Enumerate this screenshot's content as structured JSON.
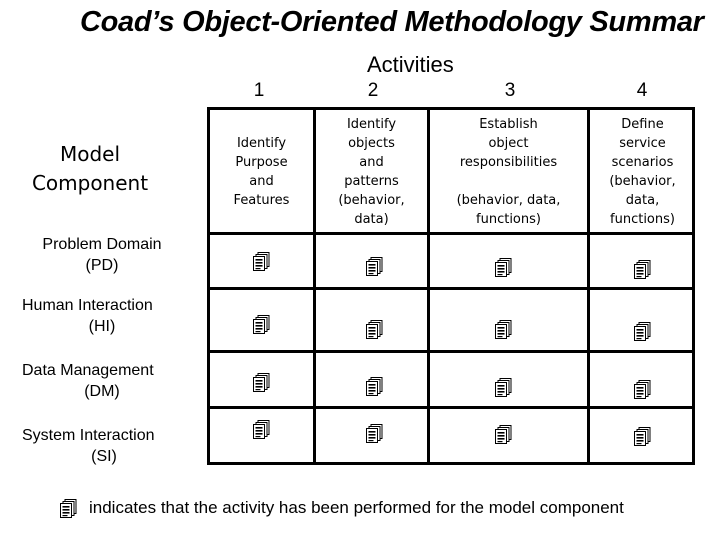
{
  "title": "Coad’s Object-Oriented Methodology Summar",
  "activities_label": "Activities",
  "model_component_label": [
    "Model",
    "Component"
  ],
  "columns": [
    {
      "number": "1",
      "description": [
        "Identify",
        "Purpose",
        "and",
        "Features"
      ]
    },
    {
      "number": "2",
      "description": [
        "Identify",
        "objects",
        "and",
        "patterns",
        "(behavior,",
        "data)"
      ]
    },
    {
      "number": "3",
      "description": [
        "Establish",
        "object",
        "responsibilities",
        "",
        "(behavior, data,",
        "functions)"
      ]
    },
    {
      "number": "4",
      "description": [
        "Define",
        "service",
        "scenarios",
        "(behavior,",
        "data,",
        "functions)"
      ]
    }
  ],
  "rows": [
    {
      "name": "Problem Domain",
      "abbr": "(PD)",
      "performed": [
        true,
        true,
        true,
        true
      ]
    },
    {
      "name": "Human Interaction",
      "abbr": "(HI)",
      "performed": [
        true,
        true,
        true,
        true
      ]
    },
    {
      "name": "Data Management",
      "abbr": "(DM)",
      "performed": [
        true,
        true,
        true,
        true
      ]
    },
    {
      "name": "System Interaction",
      "abbr": "(SI)",
      "performed": [
        true,
        true,
        true,
        true
      ]
    }
  ],
  "legend": {
    "icon": "document-stack-icon",
    "text": "indicates that the activity has been performed for the model component"
  }
}
